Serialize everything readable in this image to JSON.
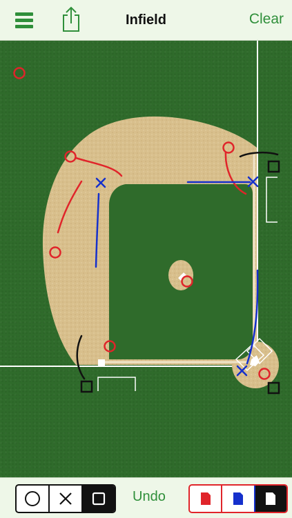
{
  "header": {
    "title": "Infield",
    "clear_label": "Clear"
  },
  "toolbar": {
    "undo_label": "Undo",
    "shape_tools": [
      {
        "name": "circle-tool",
        "icon": "circle-icon",
        "selected": false
      },
      {
        "name": "x-tool",
        "icon": "x-icon",
        "selected": false
      },
      {
        "name": "square-tool",
        "icon": "square-icon",
        "selected": true
      }
    ],
    "color_tools": [
      {
        "name": "red-pen",
        "color": "#e0242a",
        "selected": false
      },
      {
        "name": "blue-pen",
        "color": "#1530cc",
        "selected": false
      },
      {
        "name": "black-pen",
        "color": "#111111",
        "selected": true
      }
    ]
  },
  "colors": {
    "accent": "#2f8f3a",
    "grass": "#2f6b2b",
    "dirt": "#d9c08d",
    "red_mark": "#e0242a",
    "blue_mark": "#1530cc",
    "black_mark": "#111111"
  }
}
